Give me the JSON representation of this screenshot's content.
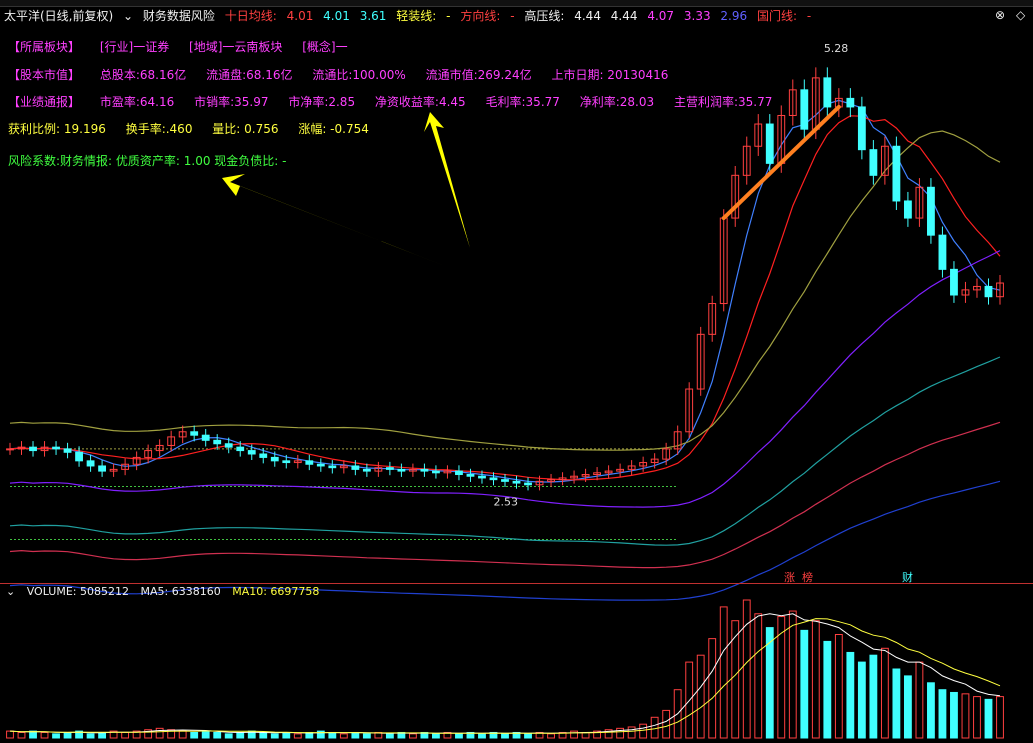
{
  "title": {
    "stock": "太平洋(日线,前复权)",
    "indicator": "财务数据风险",
    "ma10_label": "十日均线:",
    "ma10_values": [
      "4.01",
      "4.01",
      "3.61"
    ],
    "light_line_label": "轻装线:",
    "light_line_value": "-",
    "dir_line_label": "方向线:",
    "dir_line_value": "-",
    "high_press_label": "高压线:",
    "high_press_values": [
      "4.44",
      "4.44",
      "4.07",
      "3.33",
      "2.96"
    ],
    "national_label": "国门线:",
    "national_value": "-"
  },
  "info": {
    "row1": [
      "【所属板块】",
      "[行业]一证券",
      "[地域]一云南板块",
      "[概念]一"
    ],
    "row2": [
      "【股本市值】",
      "总股本:68.16亿",
      "流通盘:68.16亿",
      "流通比:100.00%",
      "流通市值:269.24亿",
      "上市日期: 20130416"
    ],
    "row3": [
      "【业绩通报】",
      "市盈率:64.16",
      "市销率:35.97",
      "市净率:2.85",
      "净资收益率:4.45",
      "毛利率:35.77",
      "净利率:28.03",
      "主营利润率:35.77"
    ],
    "row4": [
      "获利比例: 19.196",
      "换手率:.460",
      "量比: 0.756",
      "涨幅: -0.754"
    ],
    "row5": "风险系数:财务情报: 优质资产率: 1.00 现金负债比: -"
  },
  "annotations": {
    "high_price": "5.28",
    "low_price": "2.53"
  },
  "badges": [
    "涨",
    "榜",
    "财"
  ],
  "volume": {
    "label": "VOLUME: 5085212",
    "ma5": "MA5: 6338160",
    "ma10": "MA10: 6697758"
  },
  "colors": {
    "up": "#ff4040",
    "down": "#40ffff",
    "ma_blue": "#4080ff",
    "ma_red": "#ff2020",
    "ma_olive": "#a0a040",
    "ma_purple": "#8020ff",
    "ma_teal": "#20a0a0",
    "ma_orange": "#ff8020",
    "arrow": "#ffff00"
  },
  "chart_data": {
    "type": "candlestick",
    "price_range": [
      2.3,
      5.4
    ],
    "close_prices": [
      2.95,
      2.96,
      2.94,
      2.96,
      2.95,
      2.93,
      2.88,
      2.85,
      2.82,
      2.83,
      2.86,
      2.9,
      2.94,
      2.97,
      3.02,
      3.05,
      3.03,
      3.0,
      2.98,
      2.96,
      2.94,
      2.92,
      2.9,
      2.88,
      2.87,
      2.88,
      2.86,
      2.85,
      2.84,
      2.85,
      2.83,
      2.82,
      2.84,
      2.83,
      2.82,
      2.83,
      2.82,
      2.81,
      2.82,
      2.8,
      2.79,
      2.78,
      2.77,
      2.76,
      2.75,
      2.74,
      2.76,
      2.77,
      2.78,
      2.79,
      2.8,
      2.81,
      2.82,
      2.83,
      2.85,
      2.87,
      2.89,
      2.95,
      3.05,
      3.3,
      3.62,
      3.8,
      4.3,
      4.55,
      4.72,
      4.85,
      4.62,
      4.9,
      5.05,
      4.82,
      5.12,
      4.95,
      5.0,
      4.95,
      4.7,
      4.55,
      4.72,
      4.4,
      4.3,
      4.48,
      4.2,
      4.0,
      3.85,
      3.88,
      3.9,
      3.84,
      3.92
    ],
    "volume": [
      0.05,
      0.04,
      0.05,
      0.04,
      0.03,
      0.04,
      0.05,
      0.03,
      0.04,
      0.05,
      0.04,
      0.05,
      0.06,
      0.07,
      0.06,
      0.05,
      0.04,
      0.05,
      0.04,
      0.03,
      0.04,
      0.05,
      0.04,
      0.03,
      0.04,
      0.03,
      0.04,
      0.05,
      0.04,
      0.03,
      0.04,
      0.03,
      0.04,
      0.03,
      0.04,
      0.03,
      0.04,
      0.03,
      0.04,
      0.03,
      0.04,
      0.03,
      0.04,
      0.03,
      0.04,
      0.03,
      0.04,
      0.03,
      0.04,
      0.05,
      0.04,
      0.05,
      0.06,
      0.07,
      0.08,
      0.1,
      0.15,
      0.2,
      0.35,
      0.55,
      0.6,
      0.72,
      0.95,
      0.85,
      1.0,
      0.9,
      0.8,
      0.88,
      0.92,
      0.78,
      0.85,
      0.7,
      0.75,
      0.62,
      0.55,
      0.6,
      0.65,
      0.5,
      0.45,
      0.55,
      0.4,
      0.35,
      0.33,
      0.32,
      0.3,
      0.28,
      0.3
    ],
    "ylabel": "",
    "xlabel": ""
  }
}
